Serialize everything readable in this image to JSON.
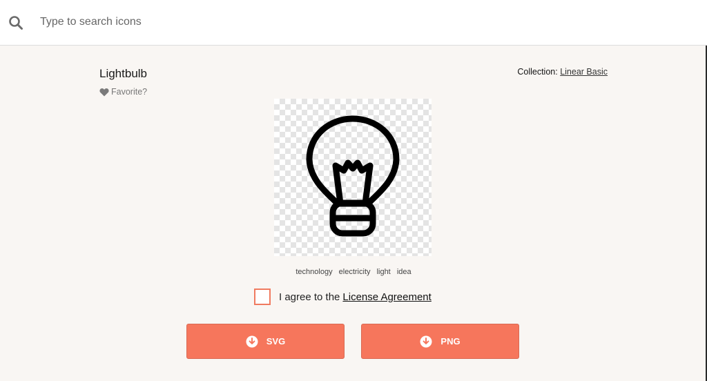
{
  "search": {
    "placeholder": "Type to search icons",
    "icon": "search-icon"
  },
  "icon": {
    "title": "Lightbulb",
    "favorite_label": "Favorite?",
    "favorite_icon": "heart-icon",
    "preview_icon": "lightbulb-icon"
  },
  "collection": {
    "label": "Collection:",
    "name": "Linear Basic"
  },
  "tags": [
    "technology",
    "electricity",
    "light",
    "idea"
  ],
  "license": {
    "text": "I agree to the",
    "link": "License Agreement",
    "checked": false
  },
  "downloads": {
    "svg_label": "SVG",
    "png_label": "PNG",
    "icon": "download-circle-icon",
    "button_color": "#f6765c"
  }
}
